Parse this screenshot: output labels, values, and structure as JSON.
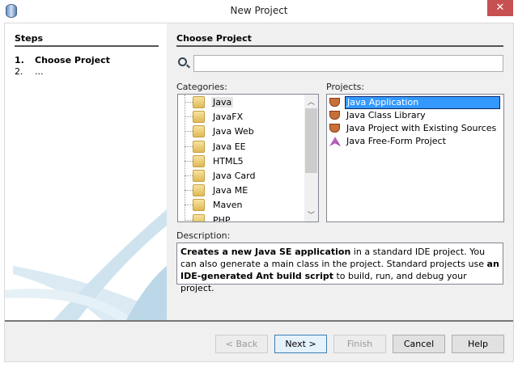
{
  "window": {
    "title": "New Project",
    "close": "✕"
  },
  "steps": {
    "heading": "Steps",
    "items": [
      {
        "num": "1.",
        "label": "Choose Project"
      },
      {
        "num": "2.",
        "label": "..."
      }
    ]
  },
  "main": {
    "heading": "Choose Project",
    "search_value": "",
    "categories_label": "Categories:",
    "projects_label": "Projects:",
    "categories": [
      "Java",
      "JavaFX",
      "Java Web",
      "Java EE",
      "HTML5",
      "Java Card",
      "Java ME",
      "Maven",
      "PHP"
    ],
    "projects": [
      "Java Application",
      "Java Class Library",
      "Java Project with Existing Sources",
      "Java Free-Form Project"
    ],
    "description_label": "Description:",
    "description": [
      {
        "t": "Creates a new Java SE application",
        "b": true
      },
      {
        "t": " in a standard IDE project. You can also generate a main class in the project. Standard projects use ",
        "b": false
      },
      {
        "t": "an IDE-generated Ant build script",
        "b": true
      },
      {
        "t": " to build, run, and debug your project.",
        "b": false
      }
    ]
  },
  "buttons": {
    "back": "< Back",
    "next": "Next >",
    "finish": "Finish",
    "cancel": "Cancel",
    "help": "Help"
  }
}
